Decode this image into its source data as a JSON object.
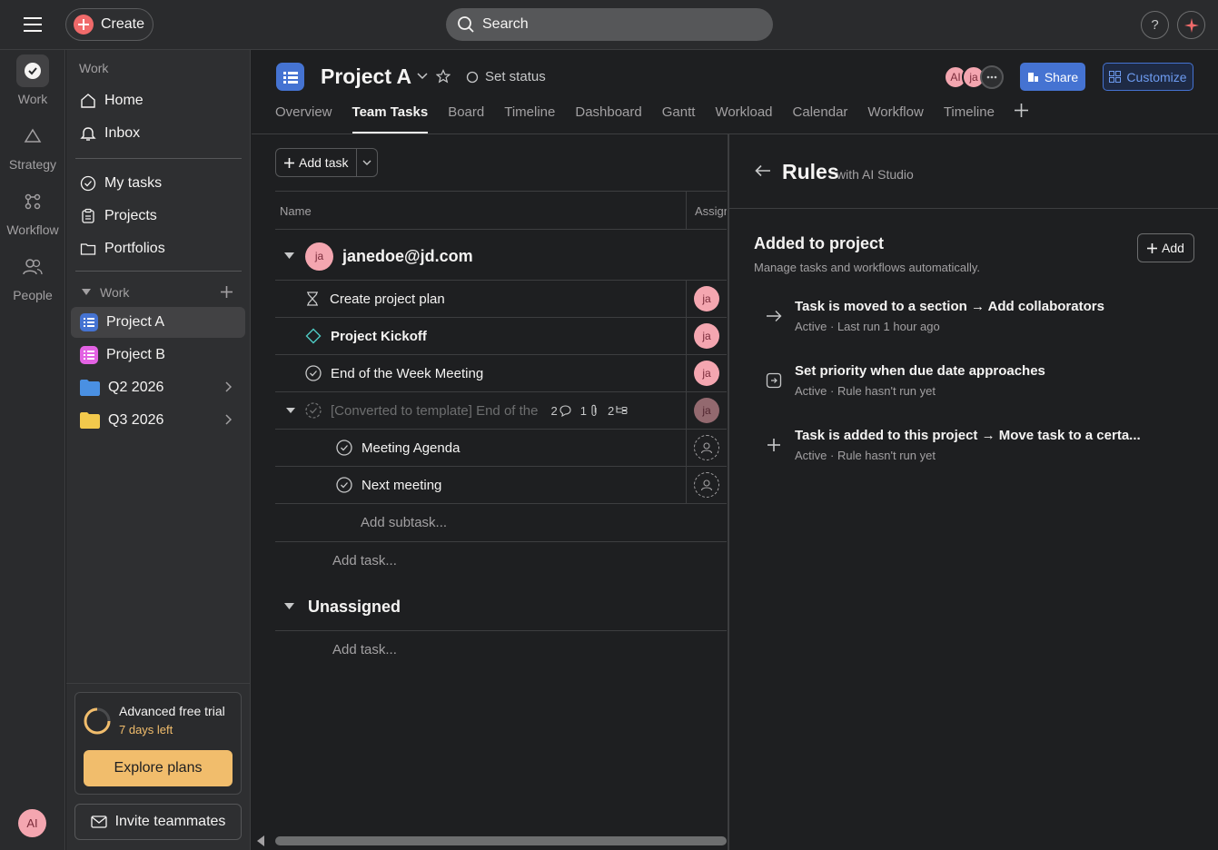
{
  "topbar": {
    "create_label": "Create",
    "search_placeholder": "Search",
    "help_label": "?"
  },
  "rail": {
    "items": [
      {
        "label": "Work",
        "icon": "check-circle-icon"
      },
      {
        "label": "Strategy",
        "icon": "triangle-icon"
      },
      {
        "label": "Workflow",
        "icon": "workflow-icon"
      },
      {
        "label": "People",
        "icon": "people-icon"
      }
    ],
    "user_initials": "AI"
  },
  "sidebar": {
    "section_title": "Work",
    "nav": [
      {
        "label": "Home",
        "icon": "home-icon"
      },
      {
        "label": "Inbox",
        "icon": "bell-icon"
      }
    ],
    "nav2": [
      {
        "label": "My tasks",
        "icon": "check-circle-icon"
      },
      {
        "label": "Projects",
        "icon": "clipboard-icon"
      },
      {
        "label": "Portfolios",
        "icon": "folder-icon"
      }
    ],
    "work_group_label": "Work",
    "projects": [
      {
        "label": "Project A",
        "color": "#4573d2",
        "active": true
      },
      {
        "label": "Project B",
        "color": "#e362e3",
        "active": false
      }
    ],
    "folders": [
      {
        "label": "Q2 2026",
        "color": "#4a90e2"
      },
      {
        "label": "Q3 2026",
        "color": "#f2c94c"
      }
    ],
    "trial": {
      "title": "Advanced free trial",
      "days": "7 days left",
      "button": "Explore plans"
    },
    "invite_label": "Invite teammates"
  },
  "project": {
    "title": "Project A",
    "set_status": "Set status",
    "tabs": [
      "Overview",
      "Team Tasks",
      "Board",
      "Timeline",
      "Dashboard",
      "Gantt",
      "Workload",
      "Calendar",
      "Workflow",
      "Timeline"
    ],
    "active_tab": 1,
    "members": [
      "AI",
      "ja"
    ],
    "share_label": "Share",
    "customize_label": "Customize"
  },
  "list": {
    "add_task_label": "Add task",
    "col_name": "Name",
    "col_assignee": "Assign",
    "group1": {
      "avatar": "ja",
      "name": "janedoe@jd.com"
    },
    "tasks": [
      {
        "name": "Create project plan",
        "icon": "hourglass-icon",
        "assignee": "ja"
      },
      {
        "name": "Project Kickoff",
        "icon": "milestone-diamond-icon",
        "assignee": "ja"
      },
      {
        "name": "End of the Week Meeting",
        "icon": "check-circle-icon",
        "assignee": "ja"
      },
      {
        "name": "[Converted to template] End of the",
        "icon": "check-circle-dashed-icon",
        "assignee": "ja",
        "comments": "2",
        "attachments": "1",
        "subtasks": "2"
      }
    ],
    "subtasks": [
      {
        "name": "Meeting Agenda"
      },
      {
        "name": "Next meeting"
      }
    ],
    "add_subtask": "Add subtask...",
    "add_task_row": "Add task...",
    "group2": "Unassigned",
    "add_task_row2": "Add task..."
  },
  "rules": {
    "title": "Rules",
    "subtitle": "with AI Studio",
    "section_title": "Added to project",
    "section_sub": "Manage tasks and workflows automatically.",
    "add_label": "Add",
    "items": [
      {
        "name": "Task is moved to a section → Add collaborators",
        "meta": "Active · Last run 1 hour ago",
        "icon": "arrow-right-icon"
      },
      {
        "name": "Set priority when due date approaches",
        "meta": "Active · Rule hasn't run yet",
        "icon": "calendar-rule-icon"
      },
      {
        "name": "Task is added to this project → Move task to a certa...",
        "meta": "Active · Rule hasn't run yet",
        "icon": "plus-icon"
      }
    ]
  }
}
